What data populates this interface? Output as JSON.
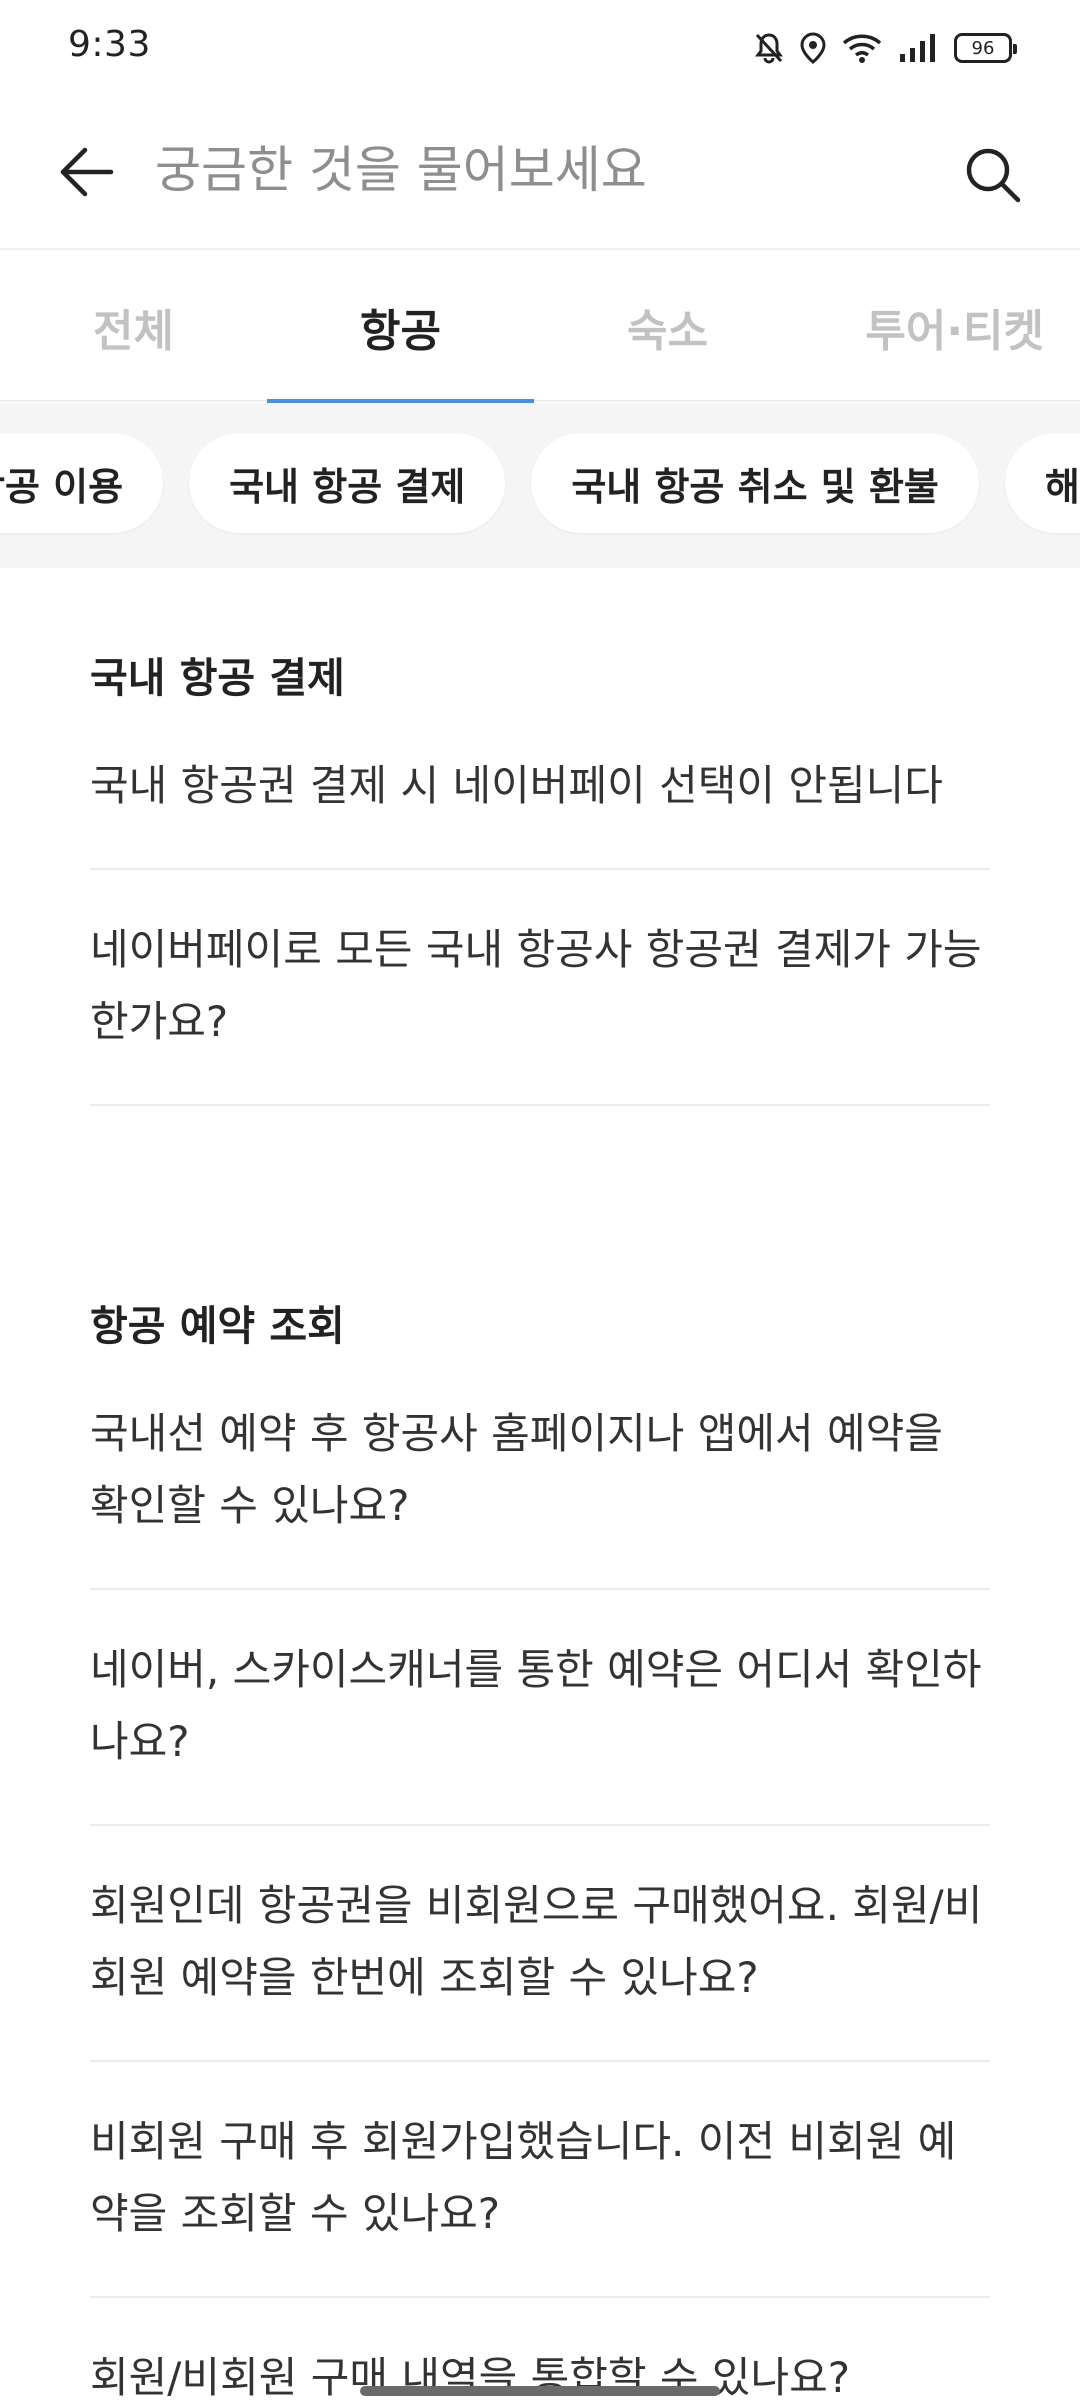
{
  "status_bar": {
    "time": "9:33",
    "battery": "96",
    "icons": [
      "bell-off-icon",
      "location-icon",
      "wifi-icon",
      "signal-icon",
      "battery-icon"
    ]
  },
  "search": {
    "placeholder": "궁금한 것을 물어보세요",
    "back_icon": "arrow-left-icon",
    "search_icon": "search-icon"
  },
  "tabs": [
    {
      "label": "전체",
      "active": false
    },
    {
      "label": "항공",
      "active": true
    },
    {
      "label": "숙소",
      "active": false
    },
    {
      "label": "투어·티켓",
      "active": false
    }
  ],
  "chips": [
    {
      "label": "항공 이용"
    },
    {
      "label": "국내 항공 결제"
    },
    {
      "label": "국내 항공 취소 및 환불"
    },
    {
      "label": "해외"
    }
  ],
  "sections": [
    {
      "title": "국내 항공 결제",
      "items": [
        "국내 항공권 결제 시 네이버페이 선택이 안됩니다",
        "네이버페이로 모든 국내 항공사 항공권 결제가 가능한가요?"
      ]
    },
    {
      "title": "항공 예약 조회",
      "items": [
        "국내선 예약 후 항공사 홈페이지나 앱에서 예약을 확인할 수 있나요?",
        "네이버, 스카이스캐너를 통한 예약은 어디서 확인하나요?",
        "회원인데 항공권을 비회원으로 구매했어요. 회원/비회원 예약을 한번에 조회할 수 있나요?",
        "비회원 구매 후 회원가입했습니다. 이전 비회원 예약을 조회할 수 있나요?",
        "회원/비회원 구매 내역을 통합할 수 있나요?"
      ]
    }
  ],
  "colors": {
    "accent": "#4a90e2",
    "inactive_tab": "#c2c2c2",
    "chip_bar_bg": "#f5f5f5"
  }
}
